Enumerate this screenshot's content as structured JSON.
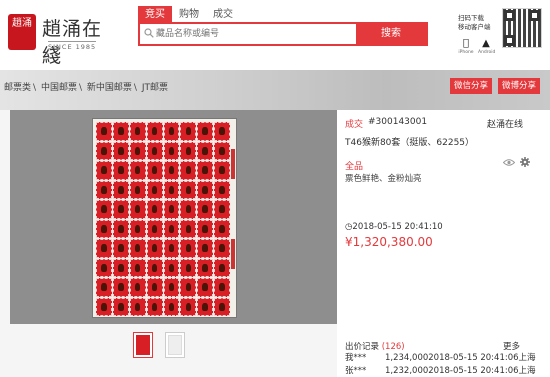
{
  "logo": {
    "seal_text": "趙涌",
    "name": "趙涌在綫",
    "since": "SINCE 1985"
  },
  "tabs": [
    {
      "label": "竞买"
    },
    {
      "label": "购物"
    },
    {
      "label": "成交"
    }
  ],
  "search": {
    "placeholder": "藏品名称或编号",
    "button": "搜索"
  },
  "qr_promo": {
    "line1": "扫码下载",
    "line2": "移动客户端"
  },
  "apps": [
    {
      "icon": "apple-icon",
      "label": "iPhone"
    },
    {
      "icon": "android-icon",
      "label": "Android"
    }
  ],
  "breadcrumb": [
    "邮票类",
    "中国邮票",
    "新中国邮票",
    "JT邮票"
  ],
  "share": {
    "wechat": "微信分享",
    "weibo": "微博分享"
  },
  "item": {
    "status": "成交",
    "lot_no": "#300143001",
    "seller": "赵涌在线",
    "title": "T46猴新80套（挺版、62255）",
    "grade": "全品",
    "description": "票色鲜艳、金粉灿亮",
    "time": "2018-05-15  20:41:10",
    "price": "¥1,320,380.00"
  },
  "bids": {
    "title": "出价记录",
    "count": "(126)",
    "more": "更多",
    "rows": [
      {
        "user": "我***",
        "detail": "1,234,0002018-05-15 20:41:06上海"
      },
      {
        "user": "张*** ",
        "detail": "1,232,0002018-05-15 20:41:06上海"
      }
    ]
  },
  "colors": {
    "accent": "#e4393c",
    "stamp_red": "#d81f26"
  }
}
